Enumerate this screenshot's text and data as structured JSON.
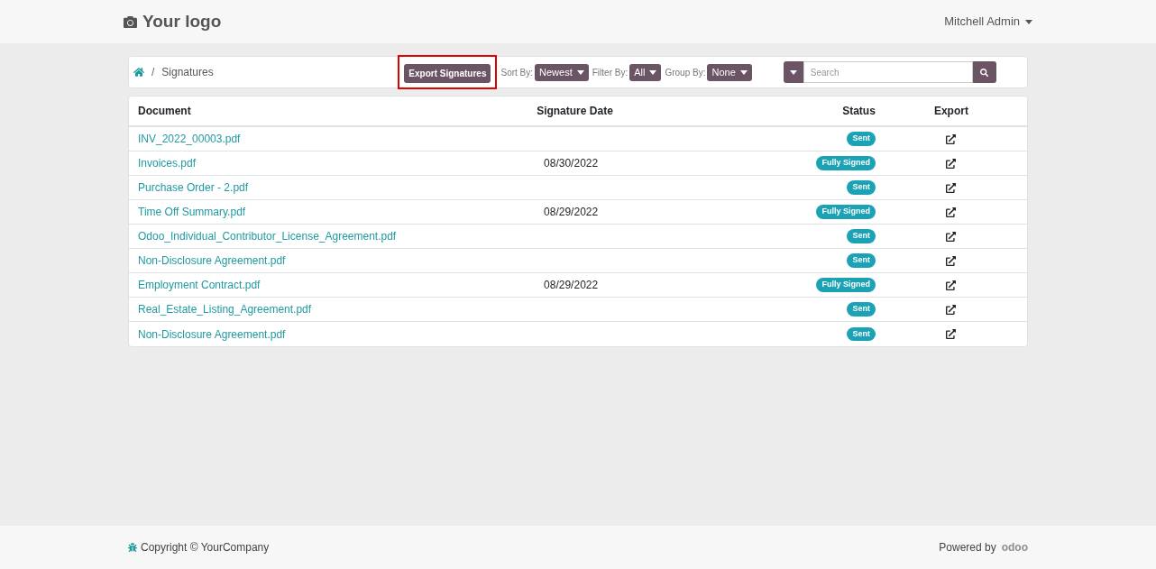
{
  "header": {
    "logo": "Your logo",
    "user": "Mitchell Admin"
  },
  "toolbar": {
    "breadcrumb_separator": "/",
    "breadcrumb": "Signatures",
    "export_button": {
      "label": "Export Signatures",
      "highlighted": true
    },
    "filters": [
      {
        "label": "Sort By:",
        "value": "Newest"
      },
      {
        "label": "Filter By:",
        "value": "All"
      },
      {
        "label": "Group By:",
        "value": "None"
      }
    ],
    "search": {
      "placeholder": "Search"
    }
  },
  "table": {
    "columns": [
      "Document",
      "Signature Date",
      "Status",
      "Export"
    ],
    "rows": [
      {
        "document": "INV_2022_00003.pdf",
        "date": "",
        "status": "Sent"
      },
      {
        "document": "Invoices.pdf",
        "date": "08/30/2022",
        "status": "Fully Signed"
      },
      {
        "document": "Purchase Order - 2.pdf",
        "date": "",
        "status": "Sent"
      },
      {
        "document": "Time Off Summary.pdf",
        "date": "08/29/2022",
        "status": "Fully Signed"
      },
      {
        "document": "Odoo_Individual_Contributor_License_Agreement.pdf",
        "date": "",
        "status": "Sent"
      },
      {
        "document": "Non-Disclosure Agreement.pdf",
        "date": "",
        "status": "Sent"
      },
      {
        "document": "Employment Contract.pdf",
        "date": "08/29/2022",
        "status": "Fully Signed"
      },
      {
        "document": "Real_Estate_Listing_Agreement.pdf",
        "date": "",
        "status": "Sent"
      },
      {
        "document": "Non-Disclosure Agreement.pdf",
        "date": "",
        "status": "Sent"
      }
    ]
  },
  "footer": {
    "copyright": "Copyright © YourCompany",
    "powered_by": "Powered by",
    "brand": "odoo"
  }
}
